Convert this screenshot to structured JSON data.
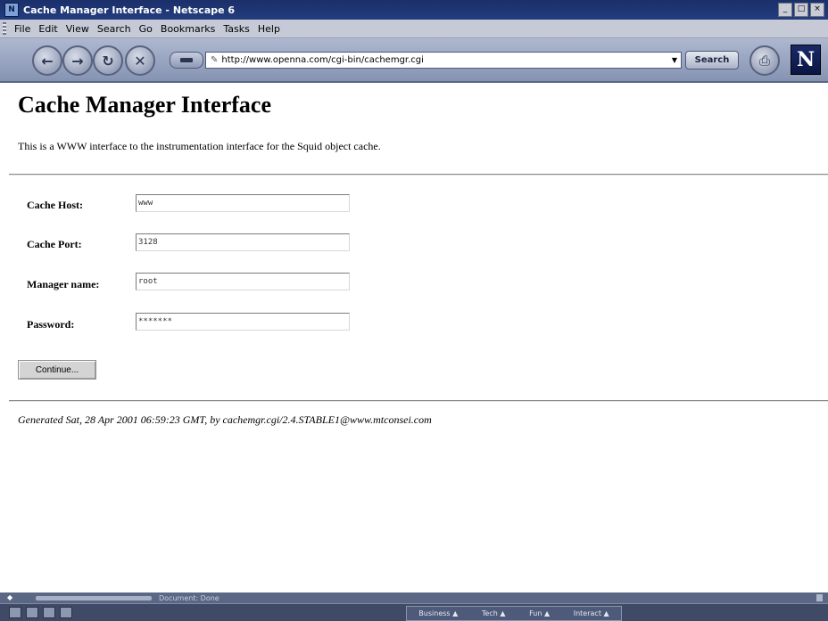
{
  "window": {
    "title": "Cache Manager Interface - Netscape 6",
    "controls": [
      "_",
      "□",
      "×"
    ]
  },
  "menu": [
    "File",
    "Edit",
    "View",
    "Search",
    "Go",
    "Bookmarks",
    "Tasks",
    "Help"
  ],
  "navbar": {
    "url": "http://www.openna.com/cgi-bin/cachemgr.cgi",
    "search_label": "Search",
    "logo": "N"
  },
  "page": {
    "title": "Cache Manager Interface",
    "intro": "This is a WWW interface to the instrumentation interface for the Squid object cache.",
    "fields": {
      "host": {
        "label": "Cache Host:",
        "value": "www"
      },
      "port": {
        "label": "Cache Port:",
        "value": "3128"
      },
      "manager": {
        "label": "Manager name:",
        "value": "root"
      },
      "password": {
        "label": "Password:",
        "value": "*******"
      }
    },
    "continue_label": "Continue...",
    "footer": "Generated Sat, 28 Apr 2001 06:59:23 GMT, by cachemgr.cgi/2.4.STABLE1@www.mtconsei.com"
  },
  "status": {
    "text": "Document: Done"
  },
  "taskbar": {
    "tabs": [
      "Business ▲",
      "Tech ▲",
      "Fun ▲",
      "Interact ▲"
    ]
  }
}
